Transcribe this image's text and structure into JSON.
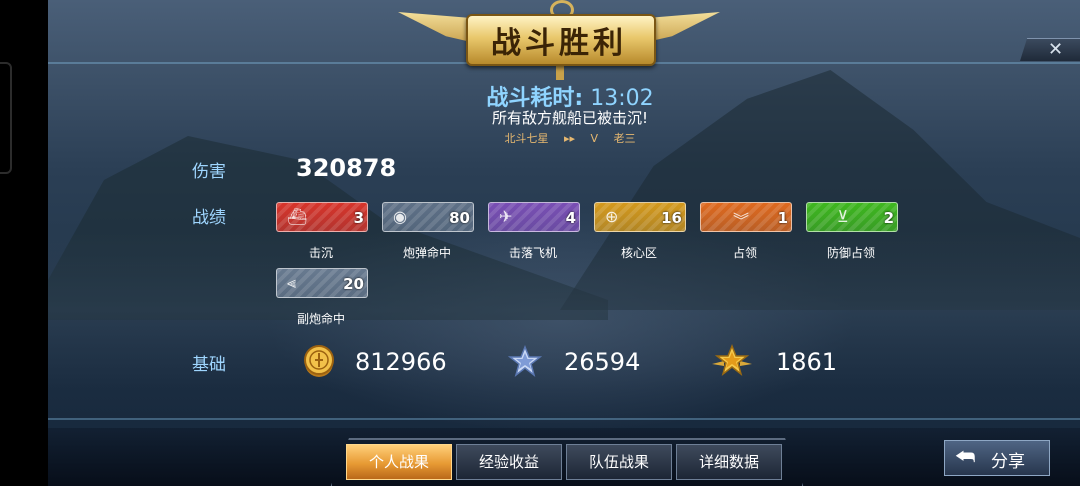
{
  "header": {
    "title": "战斗胜利",
    "close_glyph": "✕",
    "duration_label": "战斗耗时:",
    "duration_value": "13:02",
    "message": "所有敌方舰船已被击沉!",
    "team_left": "北斗七星",
    "versus": "V",
    "team_right": "老三"
  },
  "damage": {
    "label": "伤害",
    "value": "320878"
  },
  "record": {
    "label": "战绩",
    "medals": [
      {
        "label": "击沉",
        "count": "3",
        "color": "#d8352b",
        "icon": "sunk-ship-icon"
      },
      {
        "label": "炮弹命中",
        "count": "80",
        "color": "#5f7187",
        "icon": "shell-hit-icon"
      },
      {
        "label": "击落飞机",
        "count": "4",
        "color": "#7a4fb5",
        "icon": "plane-down-icon"
      },
      {
        "label": "核心区",
        "count": "16",
        "color": "#d59a1d",
        "icon": "citadel-icon"
      },
      {
        "label": "占领",
        "count": "1",
        "color": "#e06a1f",
        "icon": "capture-icon"
      },
      {
        "label": "防御占领",
        "count": "2",
        "color": "#3fb81f",
        "icon": "defend-capture-icon"
      },
      {
        "label": "副炮命中",
        "count": "20",
        "color": "#687a90",
        "icon": "secondary-hit-icon"
      }
    ]
  },
  "base": {
    "label": "基础",
    "resources": [
      {
        "icon": "gold-coin-icon",
        "value": "812966"
      },
      {
        "icon": "silver-star-icon",
        "value": "26594"
      },
      {
        "icon": "gold-star-icon",
        "value": "1861"
      }
    ]
  },
  "tabs": [
    {
      "label": "个人战果",
      "active": true
    },
    {
      "label": "经验收益",
      "active": false
    },
    {
      "label": "队伍战果",
      "active": false
    },
    {
      "label": "详细数据",
      "active": false
    }
  ],
  "share": {
    "label": "分享",
    "icon": "back-arrow-icon"
  },
  "colors": {
    "accent_blue": "#8fd4ff",
    "gold": "#e9c86c",
    "tab_active": "#e79a34"
  }
}
